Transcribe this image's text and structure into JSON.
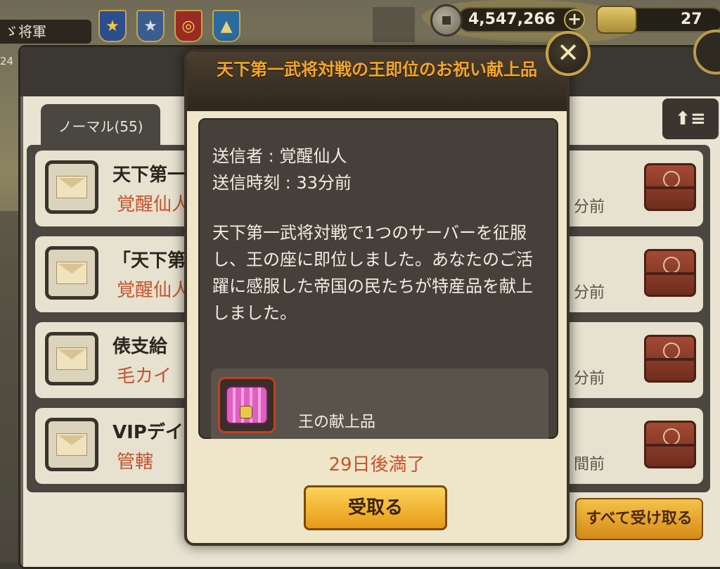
{
  "topbar": {
    "rank_title": "ゞ将軍",
    "level_stub": "24",
    "coins": "4,547,266",
    "scrolls": "27"
  },
  "mail": {
    "tab_normal": "ノーマル(55)",
    "sort_icon": "⬆≡",
    "collect_all": "すべて受け取る",
    "rows": [
      {
        "title": "天下第一",
        "sender": "覚醒仙人",
        "time": "分前"
      },
      {
        "title": "「天下第",
        "sender": "覚醒仙人",
        "time": "分前"
      },
      {
        "title": "俵支給",
        "sender": "毛カイ",
        "time": "分前"
      },
      {
        "title": "VIPデイ",
        "sender": "管轄",
        "time": "間前"
      }
    ]
  },
  "modal": {
    "title": "天下第一武将対戦の王即位のお祝い献上品",
    "sender_line": "送信者 : 覚醒仙人",
    "time_line": "送信時刻 : 33分前",
    "message": "天下第一武将対戦で1つのサーバーを征服し、王の座に即位しました。あなたのご活躍に感服した帝国の民たちが特産品を献上しました。",
    "reward_name": "王の献上品",
    "expire": "29日後満了",
    "receive_label": "受取る",
    "close_glyph": "✕"
  }
}
